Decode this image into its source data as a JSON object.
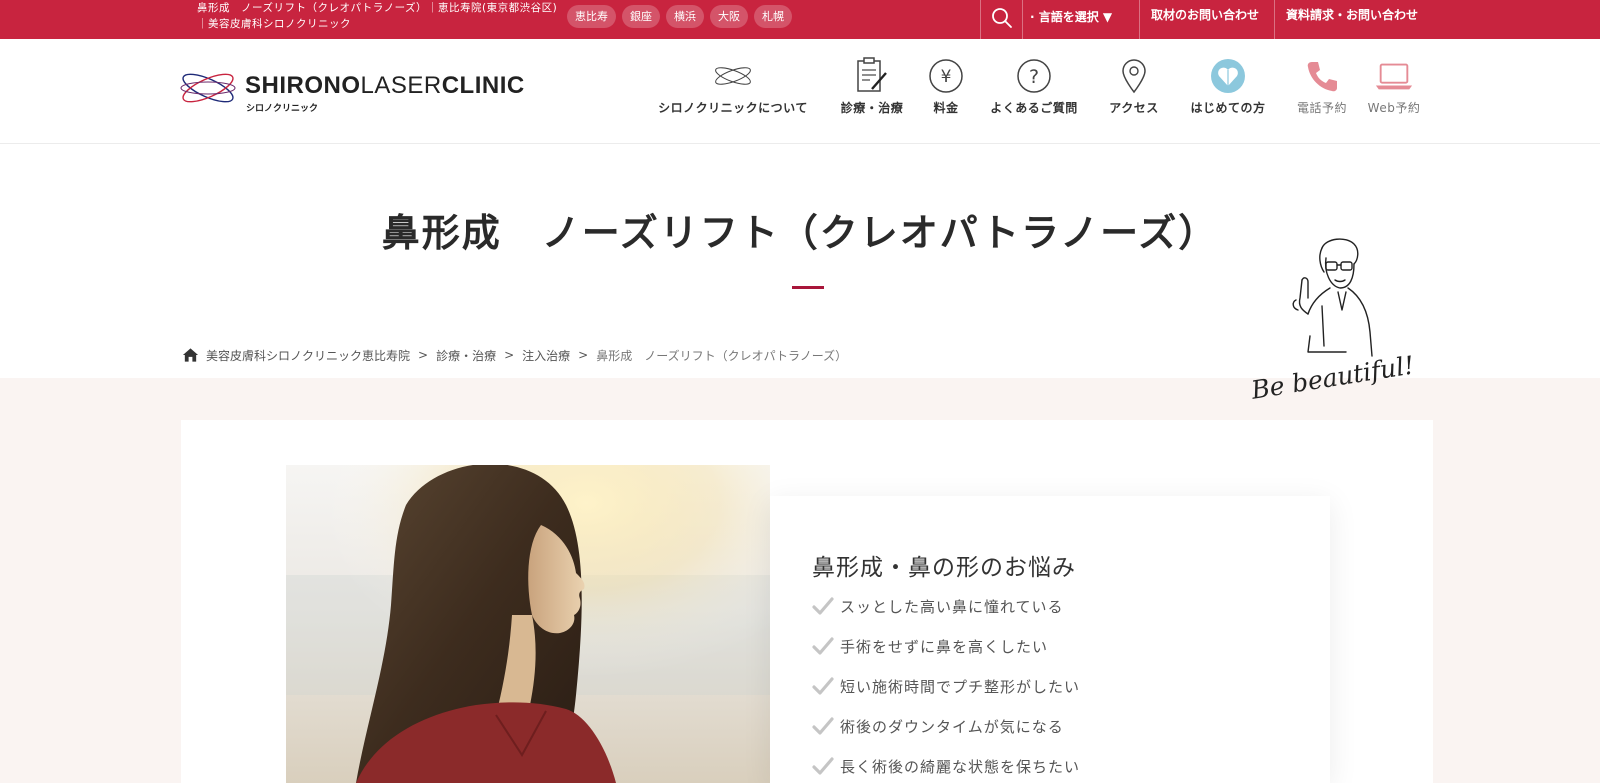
{
  "topbar": {
    "title": "鼻形成　ノーズリフト（クレオパトラノーズ）｜恵比寿院(東京都渋谷区)｜美容皮膚科シロノクリニック",
    "branches": [
      "恵比寿",
      "銀座",
      "横浜",
      "大阪",
      "札幌"
    ],
    "language_label": "· 言語を選択 ▼",
    "press_link": "取材のお問い合わせ",
    "request_link": "資料請求・お問い合わせ",
    "background_color": "#c8243f"
  },
  "header": {
    "logo_bold_1": "SHIRONO",
    "logo_thin": "LASER",
    "logo_bold_2": "CLINIC",
    "logo_sub": "シロノクリニック",
    "nav": [
      {
        "label": "シロノクリニックについて",
        "icon": "clinic-symbol-icon"
      },
      {
        "label": "診療・治療",
        "icon": "clipboard-pen-icon"
      },
      {
        "label": "料金",
        "icon": "yen-icon"
      },
      {
        "label": "よくあるご質問",
        "icon": "question-icon"
      },
      {
        "label": "アクセス",
        "icon": "map-pin-icon"
      },
      {
        "label": "はじめての方",
        "icon": "heart-badge-icon"
      },
      {
        "label": "電話予約",
        "icon": "phone-icon"
      },
      {
        "label": "Web予約",
        "icon": "laptop-icon"
      }
    ]
  },
  "page": {
    "title": "鼻形成　ノーズリフト（クレオパトラノーズ）",
    "accent_color": "#a8163a",
    "mascot_caption": "Be beautiful!"
  },
  "breadcrumb": [
    "美容皮膚科シロノクリニック恵比寿院",
    "診療・治療",
    "注入治療",
    "鼻形成　ノーズリフト（クレオパトラノーズ）"
  ],
  "worries": {
    "title": "鼻形成・鼻の形のお悩み",
    "items": [
      "スッとした高い鼻に憧れている",
      "手術をせずに鼻を高くしたい",
      "短い施術時間でプチ整形がしたい",
      "術後のダウンタイムが気になる",
      "長く術後の綺麗な状態を保ちたい"
    ]
  }
}
